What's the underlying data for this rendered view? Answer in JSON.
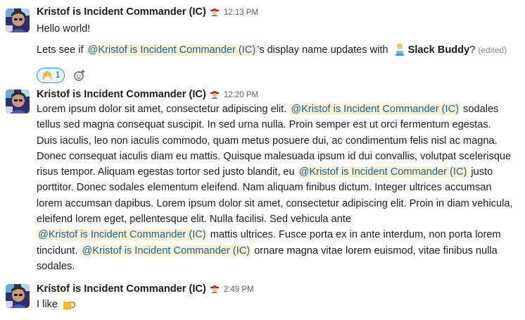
{
  "messages": [
    {
      "author": "Kristof is Incident Commander (IC)",
      "time": "12:13 PM",
      "line1": "Hello world!",
      "line2": {
        "before": "Lets see if ",
        "mention": "@Kristof is Incident Commander (IC)",
        "middle": "’s display name updates with ",
        "app_name": "Slack Buddy",
        "after": "?",
        "edited": "(edited)"
      },
      "reaction": {
        "emoji": "raised-hands",
        "count": "1"
      }
    },
    {
      "author": "Kristof is Incident Commander (IC)",
      "time": "12:20 PM",
      "lines": [
        [
          "Lorem ipsum dolor sit amet, consectetur adipiscing elit. ",
          "@Kristof is Incident Commander (IC)",
          " sodales"
        ],
        [
          "tellus sed magna consequat suscipit. In sed urna nulla. Proin semper est ut orci fermentum egestas."
        ],
        [
          "Duis iaculis, leo non iaculis commodo, quam metus posuere dui, ac condimentum felis nisl ac magna."
        ],
        [
          "Donec consequat iaculis diam eu mattis. Quisque malesuada ipsum id dui convallis, volutpat scelerisque"
        ],
        [
          "risus tempor. Aliquam egestas tortor sed justo blandit, eu ",
          "@Kristof is Incident Commander (IC)",
          " justo"
        ],
        [
          "porttitor. Donec sodales elementum eleifend. Nam aliquam finibus dictum. Integer ultrices accumsan"
        ],
        [
          "lorem accumsan dapibus. Lorem ipsum dolor sit amet, consectetur adipiscing elit. Proin in diam vehicula,"
        ],
        [
          "eleifend lorem eget, pellentesque elit. Nulla facilisi. Sed vehicula ante"
        ],
        [
          "",
          "@Kristof is Incident Commander (IC)",
          " mattis ultrices. Fusce porta ex in ante interdum, non porta lorem"
        ],
        [
          "tincidunt. ",
          "@Kristof is Incident Commander (IC)",
          " ornare magna vitae lorem euismod, vitae finibus nulla"
        ],
        [
          "sodales."
        ]
      ]
    },
    {
      "author": "Kristof is Incident Commander (IC)",
      "time": "2:49 PM",
      "text": "I like",
      "emoji": "beer-mug"
    }
  ],
  "colors": {
    "mention_bg": "#fcefd2",
    "mention_text": "#1264a3",
    "reaction_border": "#1d9bd1",
    "timestamp": "#616061"
  },
  "icons": {
    "status": "woman-firefighter",
    "avatar": "photo-avatar",
    "add_reaction": "add-reaction-icon",
    "app_avatar": "person-emoji"
  }
}
